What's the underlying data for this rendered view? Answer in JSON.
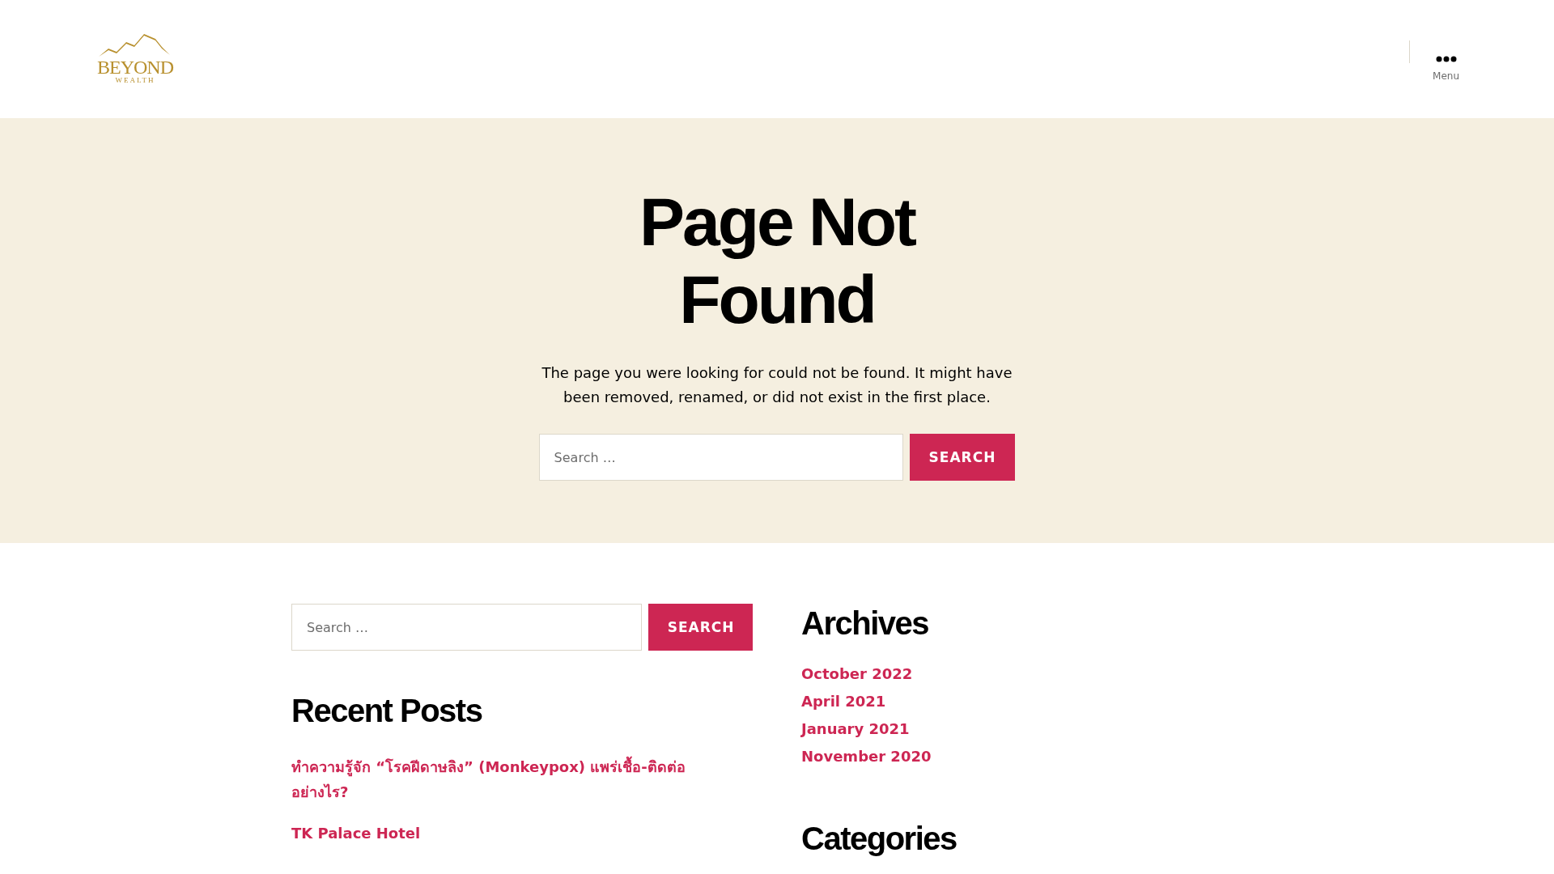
{
  "header": {
    "logo": {
      "name": "BEYOND",
      "tagline": "WEALTH"
    },
    "menu_label": "Menu"
  },
  "hero": {
    "title": "Page Not Found",
    "message": "The page you were looking for could not be found. It might have been removed, renamed, or did not exist in the first place.",
    "search": {
      "placeholder": "Search …",
      "button": "SEARCH"
    }
  },
  "widgets": {
    "search": {
      "placeholder": "Search …",
      "button": "SEARCH"
    },
    "recent_posts": {
      "title": "Recent Posts",
      "items": [
        "ทำความรู้จัก “โรคฝีดาษลิง” (Monkeypox) แพร่เชื้อ-ติดต่ออย่างไร?",
        "TK Palace Hotel"
      ]
    },
    "archives": {
      "title": "Archives",
      "items": [
        "October 2022",
        "April 2021",
        "January 2021",
        "November 2020"
      ]
    },
    "categories": {
      "title": "Categories"
    }
  }
}
